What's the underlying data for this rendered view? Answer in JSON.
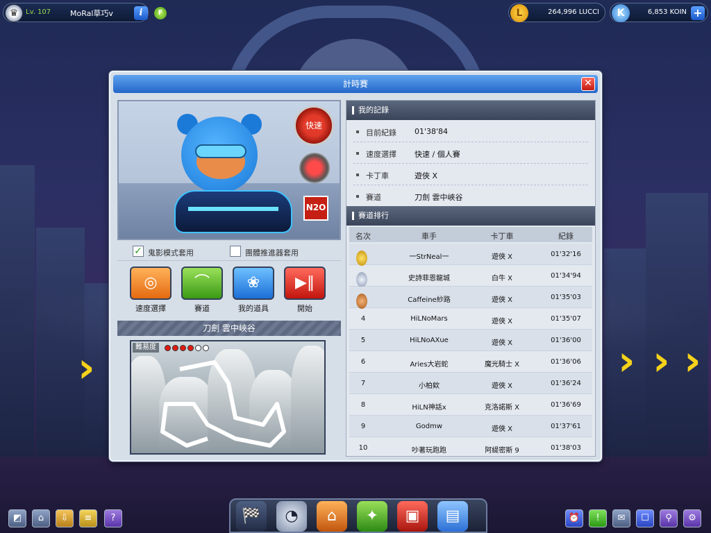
{
  "player": {
    "level": "Lv. 107",
    "name": "MoRal草巧v"
  },
  "currency": {
    "lucci": "264,996 LUCCI",
    "koin": "6,853 KOIN"
  },
  "dialog": {
    "title": "計時賽"
  },
  "kart": {
    "speed_badge": "快速",
    "n2o_label": "N2O"
  },
  "options": {
    "ghost_mode": "鬼影模式套用",
    "team_booster": "團體推進器套用"
  },
  "actions": [
    {
      "label": "速度選擇"
    },
    {
      "label": "賽道"
    },
    {
      "label": "我的道具"
    },
    {
      "label": "開始"
    }
  ],
  "track": {
    "name": "刀劍 雲中峽谷",
    "difficulty_label": "難易度",
    "difficulty": 4,
    "difficulty_max": 6
  },
  "my_record": {
    "heading": "我的記錄",
    "rows": [
      {
        "key": "目前紀錄",
        "value": "01'38'84"
      },
      {
        "key": "速度選擇",
        "value": "快速 / 個人賽"
      },
      {
        "key": "卡丁車",
        "value": "遊俠 X"
      },
      {
        "key": "賽道",
        "value": "刀劍 雲中峽谷"
      }
    ]
  },
  "ranking": {
    "heading": "賽道排行",
    "columns": [
      "名次",
      "車手",
      "卡丁車",
      "紀錄"
    ],
    "rows": [
      {
        "rank": "",
        "medal": "gold",
        "driver": "一StrNeal一",
        "kart": "遊俠 X",
        "time": "01'32'16"
      },
      {
        "rank": "",
        "medal": "silver",
        "driver": "史詩菲恩龍城",
        "kart": "白牛 X",
        "time": "01'34'94"
      },
      {
        "rank": "",
        "medal": "bronze",
        "driver": "Caffeine紗路",
        "kart": "遊俠 X",
        "time": "01'35'03"
      },
      {
        "rank": "4",
        "driver": "HiLNoMars",
        "kart": "遊俠 X",
        "time": "01'35'07"
      },
      {
        "rank": "5",
        "driver": "HiLNoAXue",
        "kart": "遊俠 X",
        "time": "01'36'00"
      },
      {
        "rank": "6",
        "driver": "Aries大岩蛇",
        "kart": "魔光騎士 X",
        "time": "01'36'06"
      },
      {
        "rank": "7",
        "driver": "小柏欸",
        "kart": "遊俠 X",
        "time": "01'36'24"
      },
      {
        "rank": "8",
        "driver": "HiLN神話x",
        "kart": "克洛諾斯 X",
        "time": "01'36'69"
      },
      {
        "rank": "9",
        "driver": "Godmw",
        "kart": "遊俠 X",
        "time": "01'37'61"
      },
      {
        "rank": "10",
        "driver": "吵著玩跑跑",
        "kart": "阿緹密斯 9",
        "time": "01'38'03"
      }
    ]
  },
  "icons": {
    "player_badge": "trophy-badge-icon",
    "info": "info-icon",
    "f_icon": "f-badge-icon",
    "lucci": "lucci-coin-icon",
    "koin": "koin-coin-icon",
    "close": "close-icon"
  },
  "colors": {
    "title_bar": "#2366c9",
    "close": "#c21b12",
    "speed_badge": "#e23a2a",
    "level_text": "#9bd84a"
  }
}
